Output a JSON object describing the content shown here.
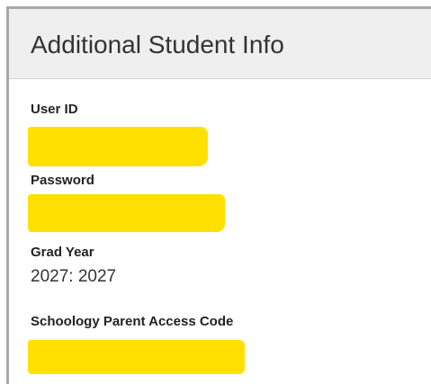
{
  "panel": {
    "title": "Additional Student Info"
  },
  "fields": [
    {
      "label": "User ID",
      "value": null,
      "redacted": true
    },
    {
      "label": "Password",
      "value": null,
      "redacted": true
    },
    {
      "label": "Grad Year",
      "value": "2027: 2027",
      "redacted": false
    },
    {
      "label": "Schoology Parent Access Code",
      "value": null,
      "redacted": true
    }
  ],
  "colors": {
    "header_bg": "#efefef",
    "border": "#a9a9a9",
    "redaction": "#ffe000",
    "label_text": "#222222",
    "value_text": "#333333"
  }
}
